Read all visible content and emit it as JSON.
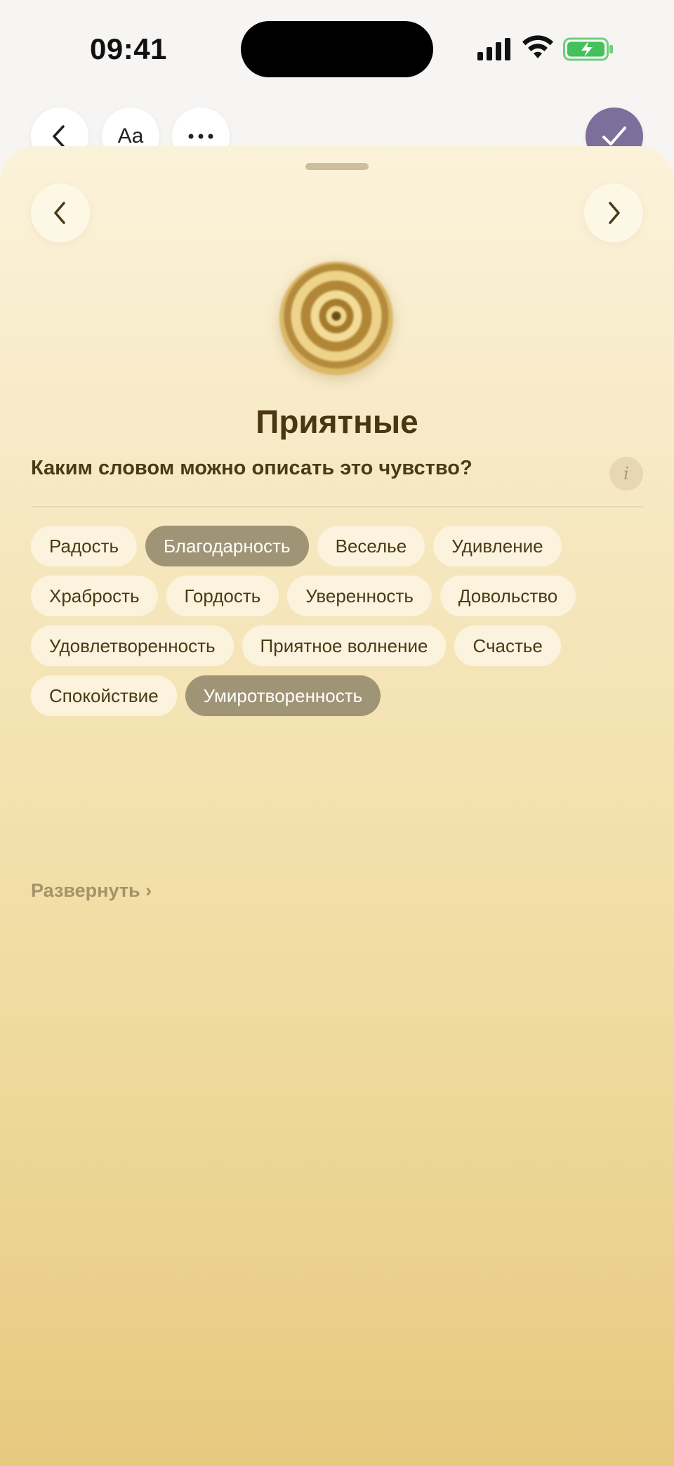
{
  "status": {
    "time": "09:41"
  },
  "toolbar": {
    "back_icon": "chevron-left-icon",
    "font_label": "Aa",
    "more_icon": "ellipsis-icon",
    "done_icon": "checkmark-icon",
    "done_color": "#7c6f9b"
  },
  "sheet": {
    "title": "Приятные",
    "question": "Каким словом можно описать это чувство?",
    "info_label": "i",
    "expand_label": "Развернуть ›",
    "emotions": [
      {
        "label": "Радость",
        "selected": false
      },
      {
        "label": "Благодарность",
        "selected": true
      },
      {
        "label": "Веселье",
        "selected": false
      },
      {
        "label": "Удивление",
        "selected": false
      },
      {
        "label": "Храбрость",
        "selected": false
      },
      {
        "label": "Гордость",
        "selected": false
      },
      {
        "label": "Уверенность",
        "selected": false
      },
      {
        "label": "Довольство",
        "selected": false
      },
      {
        "label": "Удовлетворенность",
        "selected": false
      },
      {
        "label": "Приятное волнение",
        "selected": false
      },
      {
        "label": "Счастье",
        "selected": false
      },
      {
        "label": "Спокойствие",
        "selected": false
      },
      {
        "label": "Умиротворенность",
        "selected": true
      }
    ]
  },
  "colors": {
    "chip_bg": "#fbf3dd",
    "chip_selected_bg": "#a09476",
    "title_color": "#4a3712"
  }
}
